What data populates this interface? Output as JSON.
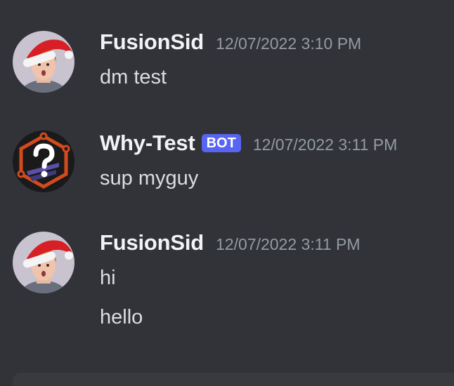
{
  "messages": [
    {
      "author": "FusionSid",
      "timestamp": "12/07/2022 3:10 PM",
      "lines": [
        "dm test"
      ]
    },
    {
      "author": "Why-Test",
      "badge": "BOT",
      "timestamp": "12/07/2022 3:11 PM",
      "lines": [
        "sup myguy"
      ]
    },
    {
      "author": "FusionSid",
      "timestamp": "12/07/2022 3:11 PM",
      "lines": [
        "hi",
        "hello"
      ]
    }
  ],
  "colors": {
    "background": "#313338",
    "username": "#f2f3f5",
    "message_text": "#dbdee1",
    "timestamp": "#949ba4",
    "bot_badge": "#5865f2",
    "composer": "#383a40"
  },
  "icons": {
    "user_avatar": "santa-hat-avatar-icon",
    "bot_avatar": "question-mark-hexagon-avatar-icon"
  }
}
